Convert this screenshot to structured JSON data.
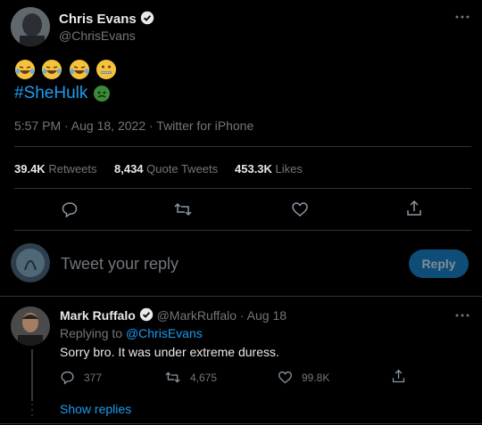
{
  "tweet": {
    "author_name": "Chris Evans",
    "author_handle": "@ChrisEvans",
    "emojis": [
      "face-with-tears-of-joy",
      "face-with-tears-of-joy",
      "face-with-tears-of-joy",
      "zipper-mouth-face"
    ],
    "hashtag": "#SheHulk",
    "timestamp": "5:57 PM · Aug 18, 2022 · Twitter for iPhone",
    "stats": {
      "retweets_count": "39.4K",
      "retweets_label": "Retweets",
      "quotes_count": "8,434",
      "quotes_label": "Quote Tweets",
      "likes_count": "453.3K",
      "likes_label": "Likes"
    }
  },
  "compose": {
    "placeholder": "Tweet your reply",
    "reply_button": "Reply"
  },
  "reply": {
    "author_name": "Mark Ruffalo",
    "author_handle": "@MarkRuffalo",
    "date": "· Aug 18",
    "replying_to_label": "Replying to",
    "replying_to_handle": "@ChrisEvans",
    "text": "Sorry bro. It was under extreme duress.",
    "comments": "377",
    "retweets": "4,675",
    "likes": "99.8K",
    "show_replies": "Show replies"
  },
  "colors": {
    "background": "#000000",
    "accent": "#1d9bf0",
    "muted": "#71767b",
    "divider": "#2f3336",
    "reply_button_bg": "#0e4d78"
  }
}
